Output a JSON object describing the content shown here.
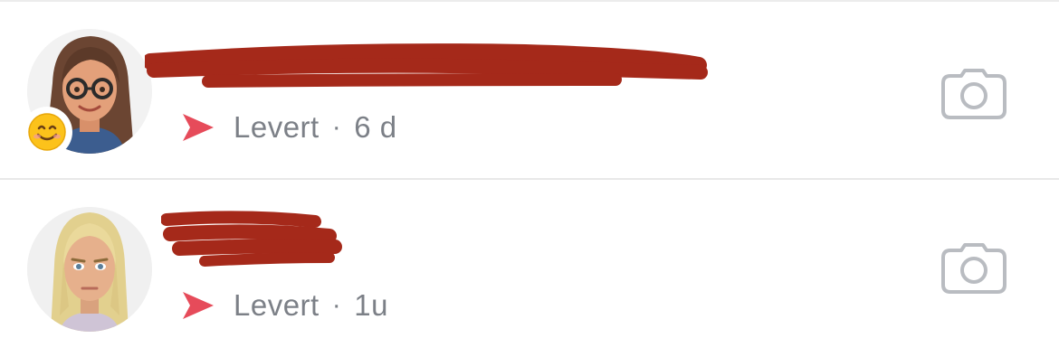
{
  "chats": [
    {
      "avatar_icon": "bitmoji-brown-hair-glasses",
      "badge_icon": "smiling-face-emoji",
      "name_redacted": true,
      "status_icon": "sent-arrow-icon",
      "status_label": "Levert",
      "separator": "·",
      "time": "6 d",
      "action_icon": "camera-icon"
    },
    {
      "avatar_icon": "bitmoji-blonde-hair",
      "name_redacted": true,
      "status_icon": "sent-arrow-icon",
      "status_label": "Levert",
      "separator": "·",
      "time": "1u",
      "action_icon": "camera-icon"
    }
  ],
  "colors": {
    "status_text": "#7c8087",
    "sent_arrow": "#e64b5a",
    "redaction": "#a5291a",
    "camera_icon": "#b9bcc1"
  }
}
